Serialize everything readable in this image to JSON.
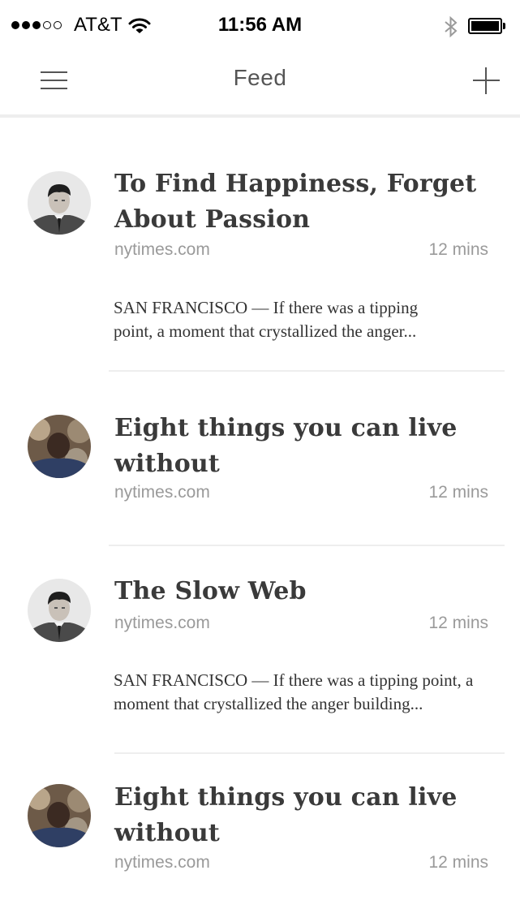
{
  "status_bar": {
    "carrier": "AT&T",
    "time": "11:56 AM",
    "signal_strength": 3,
    "signal_max": 5,
    "battery_level": 1.0,
    "icons": [
      "wifi-icon",
      "bluetooth-icon",
      "battery-icon"
    ]
  },
  "nav": {
    "title": "Feed",
    "menu_icon": "hamburger-menu-icon",
    "add_icon": "plus-icon"
  },
  "feed": [
    {
      "title_line1": "To Find Happiness, Forget",
      "title_line2": "About Passion",
      "source": "nytimes.com",
      "time": "12 mins",
      "snippet_line1": "SAN FRANCISCO — If there was a tipping",
      "snippet_line2": "point, a moment that crystallized the anger..."
    },
    {
      "title_line1": "Eight things you can live",
      "title_line2": "without",
      "source": "nytimes.com",
      "time": "12 mins"
    },
    {
      "title_line1": "The Slow Web",
      "source": "nytimes.com",
      "time": "12 mins",
      "snippet_line1": "SAN FRANCISCO — If there was a tipping point, a",
      "snippet_line2": "moment that crystallized the anger building..."
    },
    {
      "title_line1": "Eight things you can live",
      "title_line2": "without",
      "source": "nytimes.com",
      "time": "12 mins"
    }
  ],
  "colors": {
    "title": "#3a3a3a",
    "meta": "#9a9a9a",
    "divider": "#eeeeee",
    "nav_icon": "#555555"
  }
}
